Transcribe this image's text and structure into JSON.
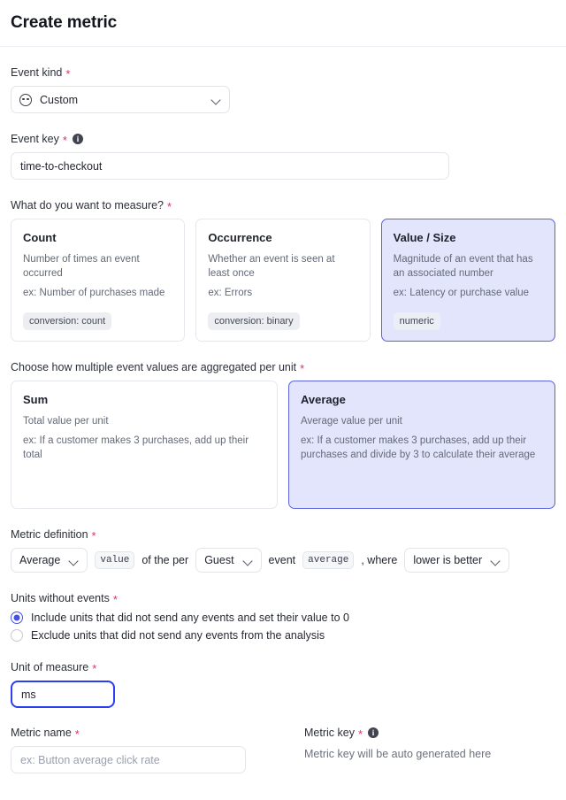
{
  "header": {
    "title": "Create metric"
  },
  "event_kind": {
    "label": "Event kind",
    "required": "*",
    "icon": "custom-event-icon",
    "value": "Custom"
  },
  "event_key": {
    "label": "Event key",
    "required": "*",
    "info_icon": "info-icon",
    "info_glyph": "i",
    "value": "time-to-checkout"
  },
  "measure": {
    "label": "What do you want to measure?",
    "required": "*",
    "options": [
      {
        "title": "Count",
        "desc": "Number of times an event occurred",
        "example": "ex: Number of purchases made",
        "badge": "conversion: count",
        "selected": false
      },
      {
        "title": "Occurrence",
        "desc": "Whether an event is seen at least once",
        "example": "ex: Errors",
        "badge": "conversion: binary",
        "selected": false
      },
      {
        "title": "Value / Size",
        "desc": "Magnitude of an event that has an associated number",
        "example": "ex: Latency or purchase value",
        "badge": "numeric",
        "selected": true
      }
    ]
  },
  "aggregation": {
    "label": "Choose how multiple event values are aggregated per unit",
    "required": "*",
    "options": [
      {
        "title": "Sum",
        "desc": "Total value per unit",
        "example": "ex: If a customer makes 3 purchases, add up their total",
        "selected": false
      },
      {
        "title": "Average",
        "desc": "Average value per unit",
        "example": "ex: If a customer makes 3 purchases, add up their purchases and divide by 3 to calculate their average",
        "selected": true
      }
    ]
  },
  "metric_definition": {
    "label": "Metric definition",
    "required": "*",
    "aggregation_value": "Average",
    "value_token": "value",
    "connector_of_the_per": "of the per",
    "unit_value": "Guest",
    "connector_event": "event",
    "event_token": "average",
    "connector_where": ", where",
    "direction_value": "lower is better"
  },
  "units_without_events": {
    "label": "Units without events",
    "required": "*",
    "options": [
      {
        "label": "Include units that did not send any events and set their value to 0",
        "checked": true
      },
      {
        "label": "Exclude units that did not send any events from the analysis",
        "checked": false
      }
    ]
  },
  "unit_of_measure": {
    "label": "Unit of measure",
    "required": "*",
    "value": "ms"
  },
  "metric_name": {
    "label": "Metric name",
    "required": "*",
    "value": "",
    "placeholder": "ex: Button average click rate"
  },
  "metric_key": {
    "label": "Metric key",
    "required": "*",
    "info_glyph": "i",
    "note": "Metric key will be auto generated here"
  },
  "colors": {
    "accent": "#4450e8",
    "selected_card_bg": "#e2e5fb",
    "selected_card_border": "#5b63e0",
    "required_asterisk": "#d6336c",
    "focus_border": "#2b3ef0"
  }
}
